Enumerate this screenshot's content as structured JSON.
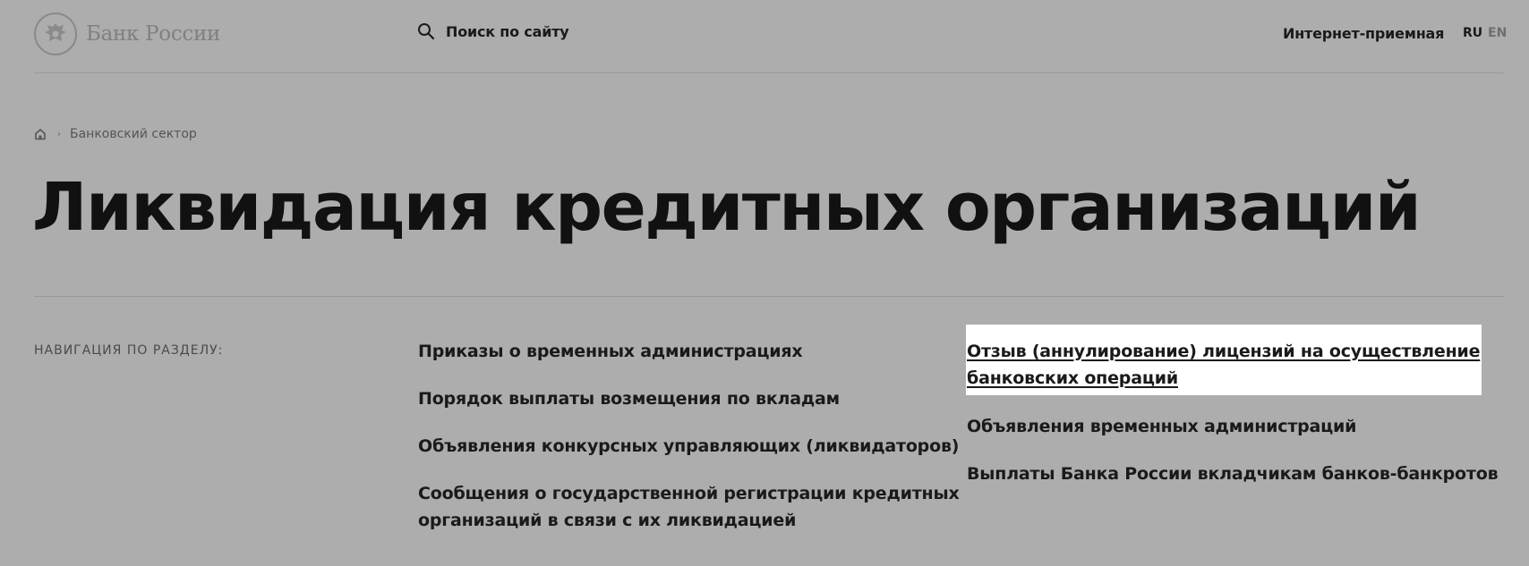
{
  "header": {
    "logo_text": "Банк России",
    "search_label": "Поиск по сайту",
    "reception_label": "Интернет-приемная",
    "lang_ru": "RU",
    "lang_en": "EN"
  },
  "breadcrumb": {
    "items": [
      "Банковский сектор"
    ]
  },
  "page_title": "Ликвидация кредитных организаций",
  "navigation": {
    "label": "НАВИГАЦИЯ ПО РАЗДЕЛУ:",
    "column1": [
      "Приказы о временных администрациях",
      "Порядок выплаты возмещения по вкладам",
      "Объявления конкурсных управляющих (ликвидаторов)",
      "Сообщения о государственной регистрации кредитных",
      "организаций в связи с их ликвидацией"
    ],
    "column2": [
      "Отзыв (аннулирование) лицензий на осуществление",
      "банковских операций",
      "Объявления временных администраций",
      "Выплаты Банка России вкладчикам банков-банкротов"
    ]
  },
  "colors": {
    "background": "#adadad",
    "highlight": "#ffffff",
    "text": "#111111"
  }
}
